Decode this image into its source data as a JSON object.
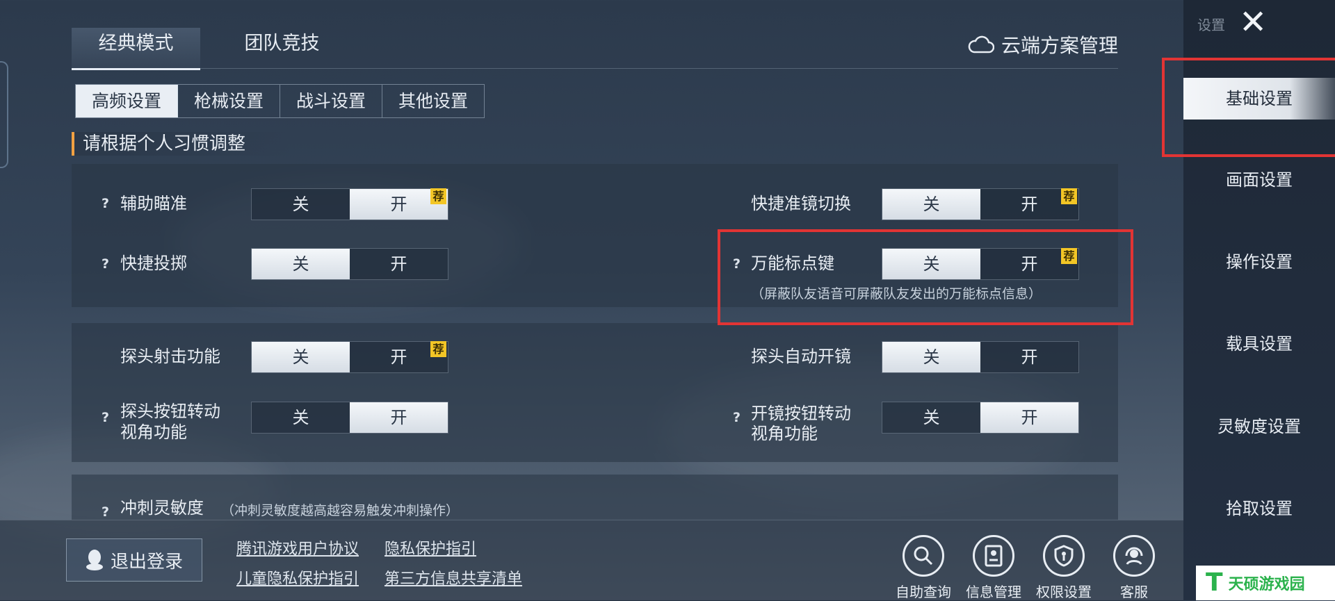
{
  "top_tabs": [
    {
      "label": "经典模式",
      "active": true
    },
    {
      "label": "团队竞技",
      "active": false
    }
  ],
  "cloud_management": "云端方案管理",
  "sub_tabs": [
    {
      "label": "高频设置",
      "active": true
    },
    {
      "label": "枪械设置",
      "active": false
    },
    {
      "label": "战斗设置",
      "active": false
    },
    {
      "label": "其他设置",
      "active": false
    }
  ],
  "hint": "请根据个人习惯调整",
  "toggle_off": "关",
  "toggle_on": "开",
  "recommend_badge": "荐",
  "settings": {
    "aim_assist": {
      "label": "辅助瞄准",
      "value": "开",
      "recommended": true
    },
    "quick_scope_switch": {
      "label": "快捷准镜切换",
      "value": "关",
      "recommended": true
    },
    "quick_throw": {
      "label": "快捷投掷",
      "value": "关"
    },
    "universal_marker": {
      "label": "万能标点键",
      "value": "关",
      "recommended": true,
      "note": "（屏蔽队友语音可屏蔽队友发出的万能标点信息）"
    },
    "peek_fire": {
      "label": "探头射击功能",
      "value": "关",
      "recommended": true
    },
    "peek_auto_scope": {
      "label": "探头自动开镜",
      "value": "关"
    },
    "peek_button_rotate": {
      "label_line1": "探头按钮转动",
      "label_line2": "视角功能",
      "value": "开"
    },
    "scope_button_rotate": {
      "label_line1": "开镜按钮转动",
      "label_line2": "视角功能",
      "value": "开"
    },
    "sprint_sensitivity": {
      "label": "冲刺灵敏度",
      "note": "（冲刺灵敏度越高越容易触发冲刺操作）"
    }
  },
  "sidebar": {
    "title": "设置",
    "items": [
      {
        "label": "基础设置",
        "active": true
      },
      {
        "label": "画面设置"
      },
      {
        "label": "操作设置"
      },
      {
        "label": "载具设置"
      },
      {
        "label": "灵敏度设置"
      },
      {
        "label": "拾取设置"
      }
    ]
  },
  "bottom": {
    "logout": "退出登录",
    "links": [
      "腾讯游戏用户协议",
      "隐私保护指引",
      "儿童隐私保护指引",
      "第三方信息共享清单"
    ],
    "tools": [
      {
        "label": "自助查询",
        "icon": "magnifier-icon"
      },
      {
        "label": "信息管理",
        "icon": "id-card-icon"
      },
      {
        "label": "权限设置",
        "icon": "shield-key-icon"
      },
      {
        "label": "客服",
        "icon": "headset-icon"
      }
    ]
  },
  "watermark": {
    "text": "天硕游戏园",
    "logo": "T"
  },
  "colors": {
    "highlight_box": "#e23434",
    "recommend": "#f3c626",
    "hint_bar": "#f2a142"
  }
}
